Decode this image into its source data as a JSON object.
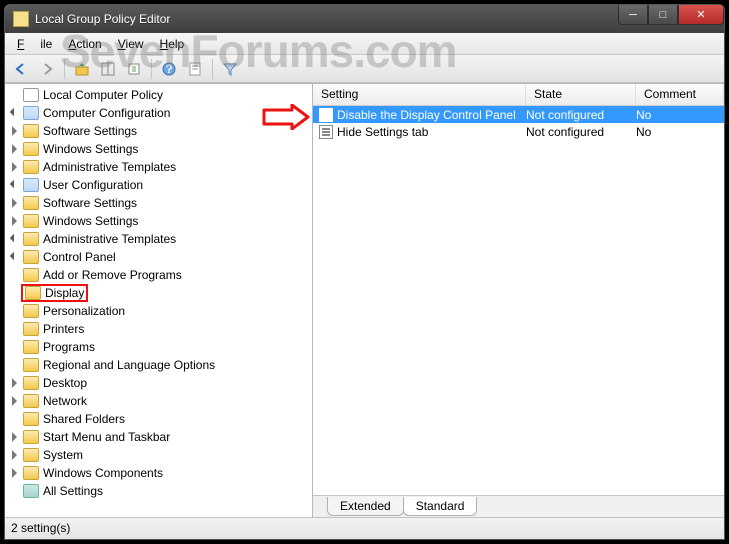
{
  "window": {
    "title": "Local Group Policy Editor"
  },
  "menubar": {
    "file": "File",
    "action": "Action",
    "view": "View",
    "help": "Help"
  },
  "tree": {
    "root": "Local Computer Policy",
    "computer": "Computer Configuration",
    "computer_children": [
      "Software Settings",
      "Windows Settings",
      "Administrative Templates"
    ],
    "user": "User Configuration",
    "user_software": "Software Settings",
    "user_windows": "Windows Settings",
    "user_admin": "Administrative Templates",
    "control_panel": "Control Panel",
    "cp_children": [
      "Add or Remove Programs",
      "Display",
      "Personalization",
      "Printers",
      "Programs",
      "Regional and Language Options"
    ],
    "admin_siblings": [
      "Desktop",
      "Network",
      "Shared Folders",
      "Start Menu and Taskbar",
      "System",
      "Windows Components",
      "All Settings"
    ]
  },
  "list": {
    "headers": {
      "setting": "Setting",
      "state": "State",
      "comment": "Comment"
    },
    "rows": [
      {
        "setting": "Disable the Display Control Panel",
        "state": "Not configured",
        "comment": "No",
        "selected": true
      },
      {
        "setting": "Hide Settings tab",
        "state": "Not configured",
        "comment": "No",
        "selected": false
      }
    ]
  },
  "tabs": {
    "extended": "Extended",
    "standard": "Standard"
  },
  "status": "2 setting(s)",
  "watermark": "SevenForums.com"
}
